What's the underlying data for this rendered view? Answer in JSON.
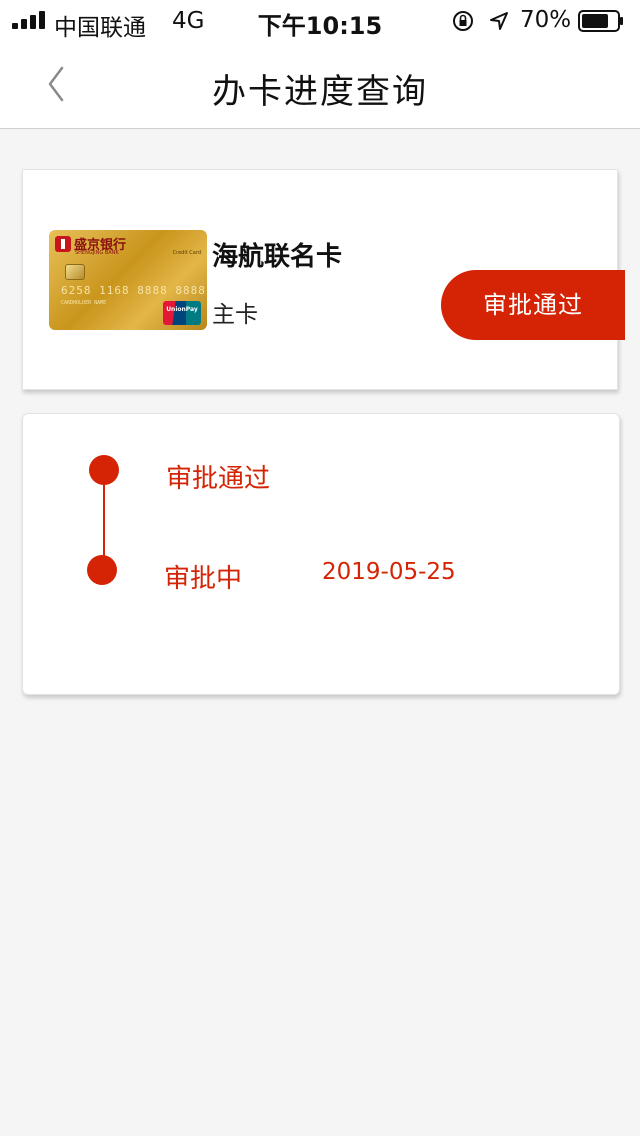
{
  "status_bar": {
    "carrier": "中国联通",
    "network": "4G",
    "time": "下午10:15",
    "battery": "70%"
  },
  "nav": {
    "title": "办卡进度查询",
    "back_icon": "chevron-left-icon"
  },
  "card": {
    "name": "海航联名卡",
    "type": "主卡",
    "status": "审批通过",
    "image": {
      "bank_name": "盛京银行",
      "bank_name_en": "SHENGJING BANK",
      "card_tag": "Credit Card",
      "number": "6258 1168 8888 8888",
      "sub": "CARDHOLDER NAME",
      "network": "UnionPay"
    }
  },
  "timeline": {
    "steps": [
      {
        "label": "审批通过",
        "date": ""
      },
      {
        "label": "审批中",
        "date": "2019-05-25"
      }
    ]
  },
  "colors": {
    "accent": "#d52405",
    "background": "#f5f5f5",
    "card_gold": "#d4a52c"
  }
}
